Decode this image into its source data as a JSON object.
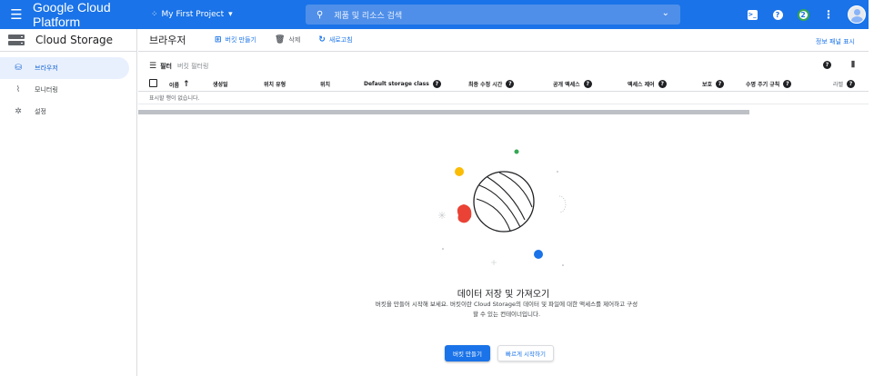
{
  "topbar": {
    "brand": "Google Cloud Platform",
    "project": "My First Project",
    "search_placeholder": "제품 및 리소스 검색",
    "notifications_count": "2",
    "icons": [
      "menu-icon",
      "search-icon",
      "cloud-shell-icon",
      "help-icon",
      "account-icon"
    ]
  },
  "sidebar": {
    "title": "Cloud Storage",
    "items": [
      {
        "label": "브라우저",
        "icon": "bucket-icon",
        "active": true
      },
      {
        "label": "모니터링",
        "icon": "chart-icon",
        "active": false
      },
      {
        "label": "설정",
        "icon": "gear-icon",
        "active": false
      }
    ]
  },
  "actionbar": {
    "title": "브라우저",
    "create_bucket": "버킷 만들기",
    "delete": "삭제",
    "refresh": "새로고침",
    "info_panel": "정보 패널 표시"
  },
  "filter": {
    "label": "필터",
    "placeholder": "버킷 필터링"
  },
  "table": {
    "columns": [
      "이름",
      "생성일",
      "위치 유형",
      "위치",
      "Default storage class",
      "최종 수정 시간",
      "공개 액세스",
      "액세스 제어",
      "보호",
      "수명 주기 규칙",
      "라벨"
    ],
    "empty_text": "표시할 행이 없습니다."
  },
  "empty_state": {
    "title": "데이터 저장 및 가져오기",
    "description": "버킷을 만들어 시작해 보세요. 버킷이란 Cloud Storage의 데이터 및 파일에 대한 액세스를 제어하고 구성할 수 있는 컨테이너입니다.",
    "primary_button": "버킷 만들기",
    "secondary_button": "빠르게 시작하기"
  },
  "colors": {
    "accent": "#1a73e8",
    "red": "#ea4335",
    "yellow": "#fbbc04",
    "green": "#34a853"
  }
}
